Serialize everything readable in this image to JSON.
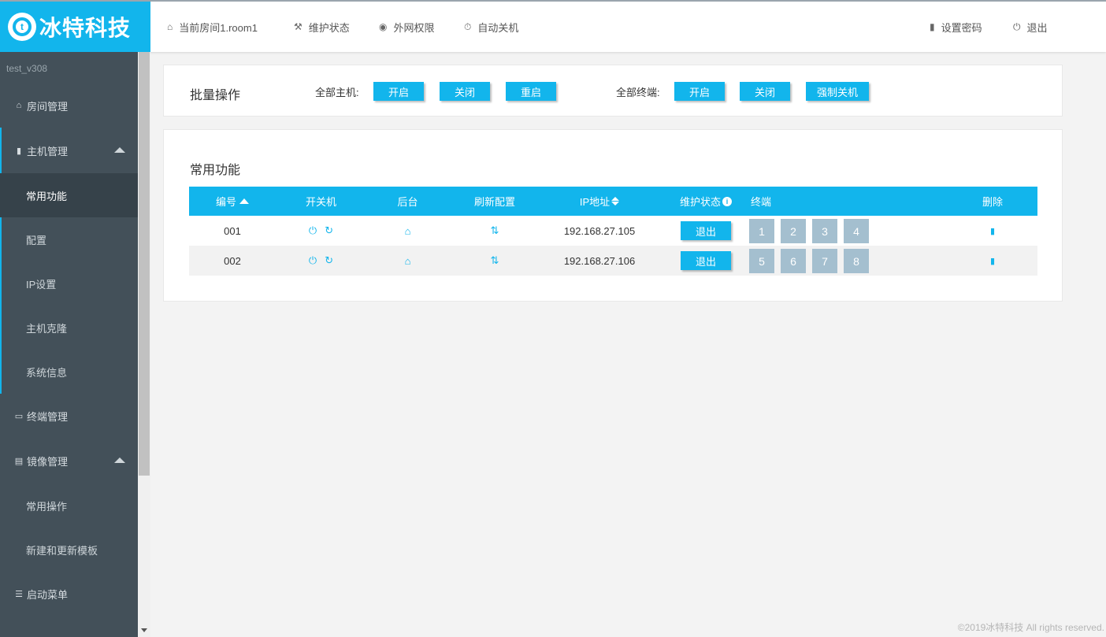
{
  "app": {
    "logo_text": "冰特科技",
    "logo_letter": "t",
    "accent_color": "#12b5ec"
  },
  "topnav": {
    "room": "当前房间1.room1",
    "maintenance": "维护状态",
    "internet": "外网权限",
    "auto_shutdown": "自动关机",
    "set_password": "设置密码",
    "logout": "退出"
  },
  "sidebar": {
    "version": "test_v308",
    "items": [
      {
        "label": "房间管理",
        "icon": "home-icon"
      },
      {
        "label": "主机管理",
        "icon": "server-icon"
      },
      {
        "label": "常用功能"
      },
      {
        "label": "配置"
      },
      {
        "label": "IP设置"
      },
      {
        "label": "主机克隆"
      },
      {
        "label": "系统信息"
      },
      {
        "label": "终端管理",
        "icon": "monitor-icon"
      },
      {
        "label": "镜像管理",
        "icon": "database-icon"
      },
      {
        "label": "常用操作"
      },
      {
        "label": "新建和更新模板"
      },
      {
        "label": "启动菜单",
        "icon": "list-icon"
      }
    ],
    "active": "常用功能"
  },
  "batch": {
    "title": "批量操作",
    "hosts_label": "全部主机:",
    "terminals_label": "全部终端:",
    "host_buttons": [
      "开启",
      "关闭",
      "重启"
    ],
    "terminal_buttons": [
      "开启",
      "关闭",
      "强制关机"
    ]
  },
  "functions": {
    "title": "常用功能",
    "columns": [
      "编号",
      "开关机",
      "后台",
      "刷新配置",
      "IP地址",
      "维护状态",
      "终端",
      "删除"
    ],
    "rows": [
      {
        "id": "001",
        "ip": "192.168.27.105",
        "status_button": "退出",
        "terminals": [
          "1",
          "2",
          "3",
          "4"
        ]
      },
      {
        "id": "002",
        "ip": "192.168.27.106",
        "status_button": "退出",
        "terminals": [
          "5",
          "6",
          "7",
          "8"
        ]
      }
    ]
  },
  "footer": "©2019冰特科技 All rights reserved."
}
